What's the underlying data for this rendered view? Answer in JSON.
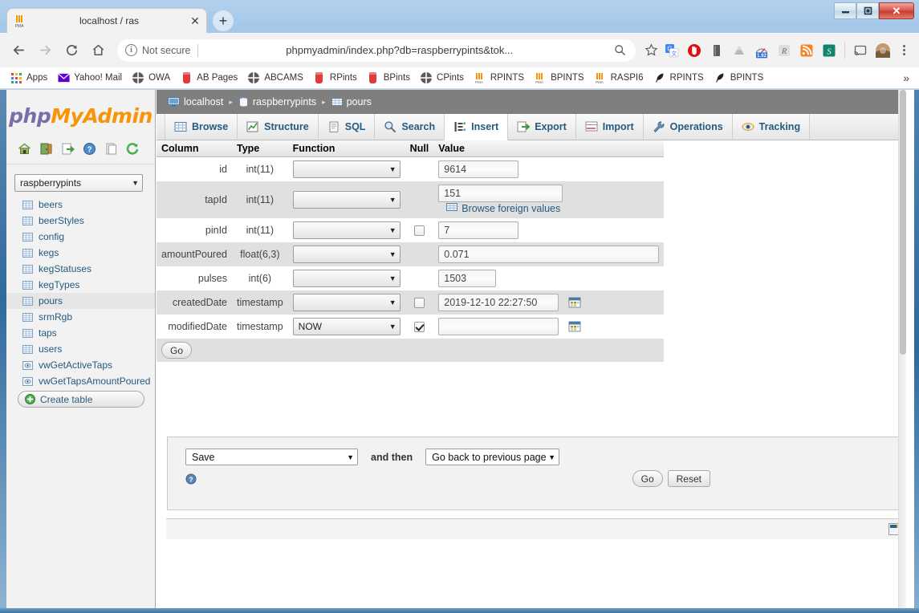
{
  "window": {
    "minimize_label": "Minimize",
    "restore_label": "Restore",
    "close_label": "✕"
  },
  "browser": {
    "tab": {
      "title": "localhost / ras",
      "favicon": "phpmyadmin-icon",
      "close_label": "✕"
    },
    "newtab_label": "+",
    "nav": {
      "back": "←",
      "forward": "→",
      "reload": "⟳",
      "home": "⌂"
    },
    "omnibox": {
      "security_label": "Not secure",
      "url": "phpmyadmin/index.php?db=raspberrypints&tok...",
      "info_glyph": "i"
    },
    "extensions": [
      {
        "name": "bookmark-star-icon",
        "label": "☆"
      },
      {
        "name": "google-translate-icon",
        "label": "G"
      },
      {
        "name": "adblock-icon",
        "label": ""
      },
      {
        "name": "pocket-book-icon",
        "label": ""
      },
      {
        "name": "google-drive-icon",
        "label": ""
      },
      {
        "name": "speed-dial-icon",
        "label": "1.92"
      },
      {
        "name": "resurrect-tabs-icon",
        "label": "R"
      },
      {
        "name": "rss-feed-icon",
        "label": ""
      },
      {
        "name": "evernote-icon",
        "label": "S"
      },
      {
        "name": "cast-icon",
        "label": ""
      },
      {
        "name": "profile-avatar-icon",
        "label": ""
      }
    ],
    "menu_label": "Chrome menu"
  },
  "bookmarks": {
    "items": [
      {
        "label": "Apps",
        "icon": "apps-grid-icon"
      },
      {
        "label": "Yahoo! Mail",
        "icon": "mail-envelope-icon"
      },
      {
        "label": "OWA",
        "icon": "globe-icon"
      },
      {
        "label": "AB Pages",
        "icon": "pint-glass-icon"
      },
      {
        "label": "ABCAMS",
        "icon": "globe-icon"
      },
      {
        "label": "RPints",
        "icon": "pint-glass-icon"
      },
      {
        "label": "BPints",
        "icon": "pint-glass-icon"
      },
      {
        "label": "CPints",
        "icon": "globe-icon"
      },
      {
        "label": "RPINTS",
        "icon": "phpmyadmin-icon"
      },
      {
        "label": "BPINTS",
        "icon": "phpmyadmin-icon"
      },
      {
        "label": "RASPI6",
        "icon": "phpmyadmin-icon"
      },
      {
        "label": "RPINTS",
        "icon": "feather-icon"
      },
      {
        "label": "BPINTS",
        "icon": "feather-icon"
      }
    ],
    "overflow_label": "»"
  },
  "pma": {
    "logo": {
      "part1": "php",
      "part2": "MyAdmin"
    },
    "quick_icons": [
      {
        "name": "home-icon",
        "title": "Home"
      },
      {
        "name": "logout-icon",
        "title": "Log out"
      },
      {
        "name": "export-icon",
        "title": "Export"
      },
      {
        "name": "help-icon",
        "title": "Help"
      },
      {
        "name": "docs-icon",
        "title": "Documentation"
      },
      {
        "name": "reload-icon",
        "title": "Reload navigation"
      }
    ],
    "database_select": {
      "value": "raspberrypints",
      "arrow": "▼"
    },
    "tables": [
      {
        "label": "beers",
        "type": "table",
        "selected": false
      },
      {
        "label": "beerStyles",
        "type": "table",
        "selected": false
      },
      {
        "label": "config",
        "type": "table",
        "selected": false
      },
      {
        "label": "kegs",
        "type": "table",
        "selected": false
      },
      {
        "label": "kegStatuses",
        "type": "table",
        "selected": false
      },
      {
        "label": "kegTypes",
        "type": "table",
        "selected": false
      },
      {
        "label": "pours",
        "type": "table",
        "selected": true
      },
      {
        "label": "srmRgb",
        "type": "table",
        "selected": false
      },
      {
        "label": "taps",
        "type": "table",
        "selected": false
      },
      {
        "label": "users",
        "type": "table",
        "selected": false
      },
      {
        "label": "vwGetActiveTaps",
        "type": "view",
        "selected": false
      },
      {
        "label": "vwGetTapsAmountPoured",
        "type": "view",
        "selected": false
      }
    ],
    "create_table_label": "Create table",
    "breadcrumb": [
      {
        "label": "localhost",
        "icon": "server-icon"
      },
      {
        "label": "raspberrypints",
        "icon": "database-icon"
      },
      {
        "label": "pours",
        "icon": "table-icon"
      }
    ],
    "breadcrumb_separator": "▸",
    "tabs": [
      {
        "label": "Browse",
        "icon": "browse-icon",
        "active": false
      },
      {
        "label": "Structure",
        "icon": "structure-icon",
        "active": false
      },
      {
        "label": "SQL",
        "icon": "sql-icon",
        "active": false
      },
      {
        "label": "Search",
        "icon": "search-icon",
        "active": false
      },
      {
        "label": "Insert",
        "icon": "insert-icon",
        "active": true
      },
      {
        "label": "Export",
        "icon": "export-icon",
        "active": false
      },
      {
        "label": "Import",
        "icon": "import-icon",
        "active": false
      },
      {
        "label": "Operations",
        "icon": "operations-icon",
        "active": false
      },
      {
        "label": "Tracking",
        "icon": "tracking-icon",
        "active": false
      }
    ],
    "insert_table": {
      "headers": [
        "Column",
        "Type",
        "Function",
        "Null",
        "Value"
      ],
      "rows": [
        {
          "column": "id",
          "type": "int(11)",
          "function": "",
          "has_null": false,
          "null_checked": false,
          "value": "9614",
          "value_width": "w100",
          "foreign": "",
          "has_calendar": false
        },
        {
          "column": "tapId",
          "type": "int(11)",
          "function": "",
          "has_null": false,
          "null_checked": false,
          "value": "151",
          "value_width": "w155",
          "foreign": "Browse foreign values",
          "has_calendar": false
        },
        {
          "column": "pinId",
          "type": "int(11)",
          "function": "",
          "has_null": true,
          "null_checked": false,
          "value": "7",
          "value_width": "w100",
          "foreign": "",
          "has_calendar": false
        },
        {
          "column": "amountPoured",
          "type": "float(6,3)",
          "function": "",
          "has_null": false,
          "null_checked": false,
          "value": "0.071",
          "value_width": "w275",
          "foreign": "",
          "has_calendar": false
        },
        {
          "column": "pulses",
          "type": "int(6)",
          "function": "",
          "has_null": false,
          "null_checked": false,
          "value": "1503",
          "value_width": "w72",
          "foreign": "",
          "has_calendar": false
        },
        {
          "column": "createdDate",
          "type": "timestamp",
          "function": "",
          "has_null": true,
          "null_checked": false,
          "value": "2019-12-10 22:27:50",
          "value_width": "w150",
          "foreign": "",
          "has_calendar": true
        },
        {
          "column": "modifiedDate",
          "type": "timestamp",
          "function": "NOW",
          "has_null": true,
          "null_checked": true,
          "value": "",
          "value_width": "w150",
          "foreign": "",
          "has_calendar": true
        }
      ],
      "go_label": "Go",
      "select_arrow": "▼"
    },
    "bottom_panel": {
      "save_select": {
        "value": "Save",
        "arrow": "▼"
      },
      "and_then_label": "and then",
      "after_select": {
        "value": "Go back to previous page",
        "arrow": "▼"
      },
      "help_icon": "help-icon",
      "go_label": "Go",
      "reset_label": "Reset"
    },
    "footer": {
      "console_icon": "console-icon"
    }
  }
}
